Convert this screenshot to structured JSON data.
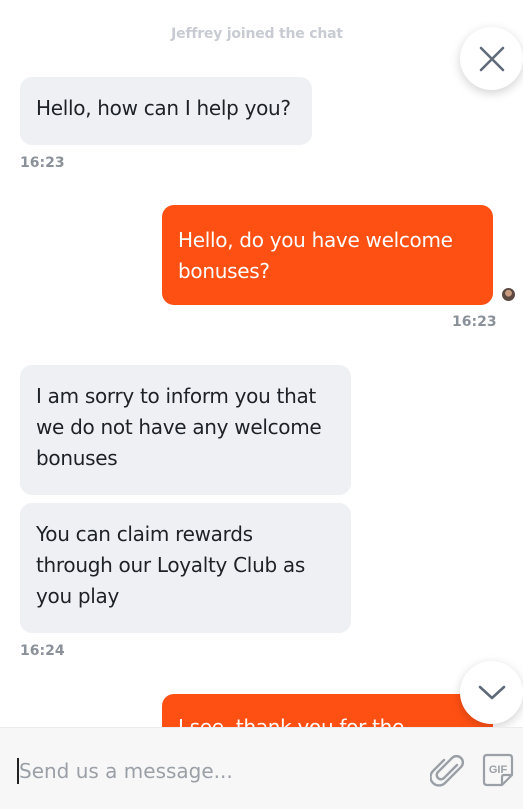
{
  "system_message": "Jeffrey joined the chat",
  "messages": [
    {
      "from": "agent",
      "text": "Hello, how can I help you?",
      "time": "16:23"
    },
    {
      "from": "user",
      "text": "Hello, do you have welcome bonuses?",
      "time": "16:23"
    },
    {
      "from": "agent",
      "text": "I am sorry to inform you that we do not have any welcome bonuses"
    },
    {
      "from": "agent",
      "text": "You can claim rewards through our Loyalty Club as you play",
      "time": "16:24"
    },
    {
      "from": "user",
      "text": "I see, thank you for the"
    }
  ],
  "composer": {
    "placeholder": "Send us a message..."
  },
  "icons": {
    "close": "close-icon",
    "scroll_down": "chevron-down-icon",
    "attach": "paperclip-icon",
    "gif": "gif-icon",
    "avatar": "user-avatar"
  },
  "colors": {
    "user_bubble": "#ff5013",
    "agent_bubble": "#eef0f4",
    "timestamp": "#8a9199",
    "system_text": "#c8cbd2"
  }
}
